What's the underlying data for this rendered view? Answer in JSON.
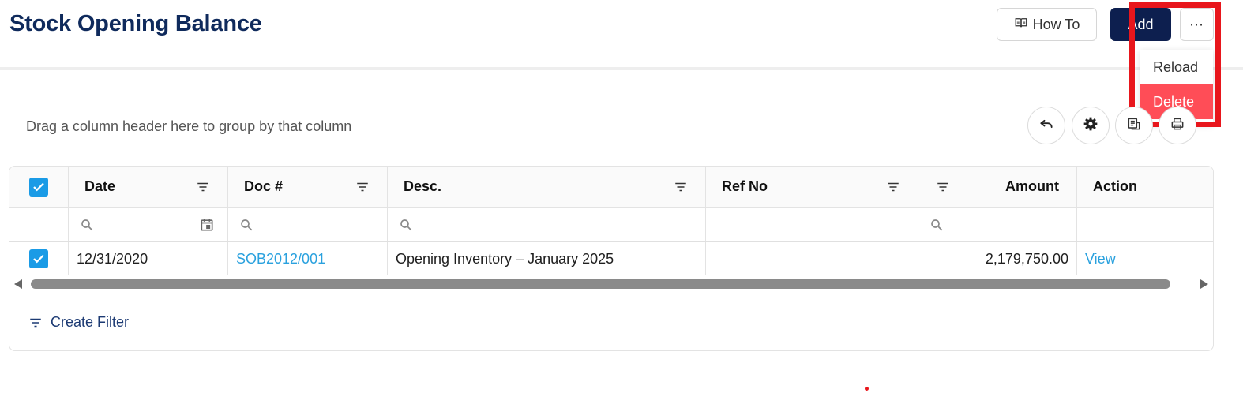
{
  "page": {
    "title": "Stock Opening Balance"
  },
  "toolbar": {
    "howto_label": "How To",
    "add_label": "Add",
    "more_label": "⋯"
  },
  "menu": {
    "items": [
      {
        "label": "Reload"
      },
      {
        "label": "Delete"
      }
    ]
  },
  "grid": {
    "group_hint": "Drag a column header here to group by that column",
    "columns": [
      "Date",
      "Doc #",
      "Desc.",
      "Ref No",
      "Amount",
      "Action"
    ],
    "rows": [
      {
        "checked": true,
        "date": "12/31/2020",
        "doc": "SOB2012/001",
        "desc": "Opening Inventory – January 2025",
        "ref": "",
        "amount": "2,179,750.00",
        "action": "View"
      }
    ],
    "create_filter": "Create Filter"
  },
  "colors": {
    "title": "#0f2a5c",
    "primary": "#0d1f4f",
    "link": "#2aa1de",
    "checkbox": "#1a9be6",
    "danger": "#ff4d57",
    "highlight": "#e8161c"
  },
  "icons": [
    "book-icon",
    "undo-icon",
    "gear-icon",
    "export-icon",
    "filter-icon",
    "search-icon",
    "calendar-icon",
    "check-icon"
  ]
}
